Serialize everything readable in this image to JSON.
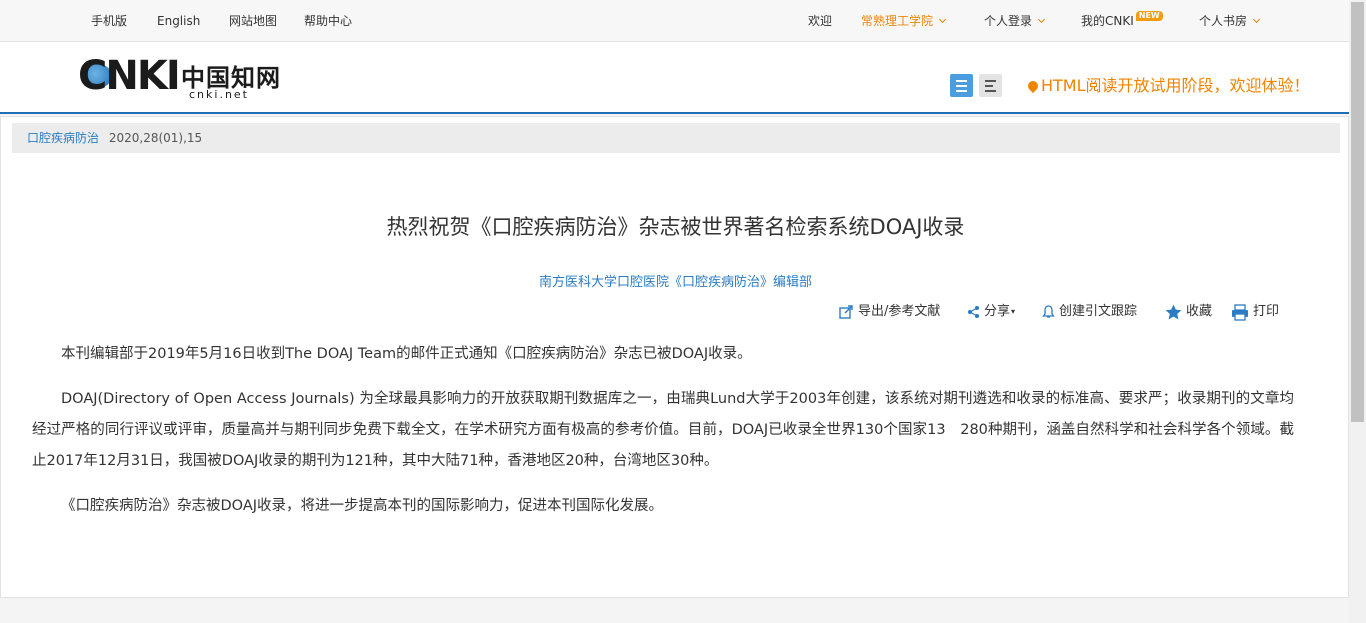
{
  "topbar": {
    "mobile": "手机版",
    "english": "English",
    "sitemap": "网站地图",
    "help": "帮助中心",
    "welcome": "欢迎",
    "institution": "常熟理工学院",
    "login": "个人登录",
    "my_cnki": "我的CNKI",
    "new_badge": "NEW",
    "bookroom": "个人书房"
  },
  "header": {
    "logo_cnki": "CNKI",
    "logo_cn": "中国知网",
    "logo_url": "cnki.net",
    "notice": "HTML阅读开放试用阶段，欢迎体验！"
  },
  "breadcrumb": {
    "journal": "口腔疾病防治",
    "issue": "2020,28(01),15"
  },
  "article": {
    "title": "热烈祝贺《口腔疾病防治》杂志被世界著名检索系统DOAJ收录",
    "author": "南方医科大学口腔医院《口腔疾病防治》编辑部",
    "paragraphs": [
      "本刊编辑部于2019年5月16日收到The DOAJ Team的邮件正式通知《口腔疾病防治》杂志已被DOAJ收录。",
      "DOAJ(Directory of Open Access Journals) 为全球最具影响力的开放获取期刊数据库之一，由瑞典Lund大学于2003年创建，该系统对期刊遴选和收录的标准高、要求严；收录期刊的文章均经过严格的同行评议或评审，质量高并与期刊同步免费下载全文，在学术研究方面有极高的参考价值。目前，DOAJ已收录全世界130个国家13　280种期刊，涵盖自然科学和社会科学各个领域。截止2017年12月31日，我国被DOAJ收录的期刊为121种，其中大陆71种，香港地区20种，台湾地区30种。",
      "《口腔疾病防治》杂志被DOAJ收录，将进一步提高本刊的国际影响力，促进本刊国际化发展。"
    ]
  },
  "tools": {
    "export": "导出/参考文献",
    "share": "分享",
    "track": "创建引文跟踪",
    "favorite": "收藏",
    "print": "打印"
  },
  "colors": {
    "brand_blue": "#1e6fb6",
    "link_blue": "#2b7cc2",
    "accent_orange": "#f08300"
  }
}
